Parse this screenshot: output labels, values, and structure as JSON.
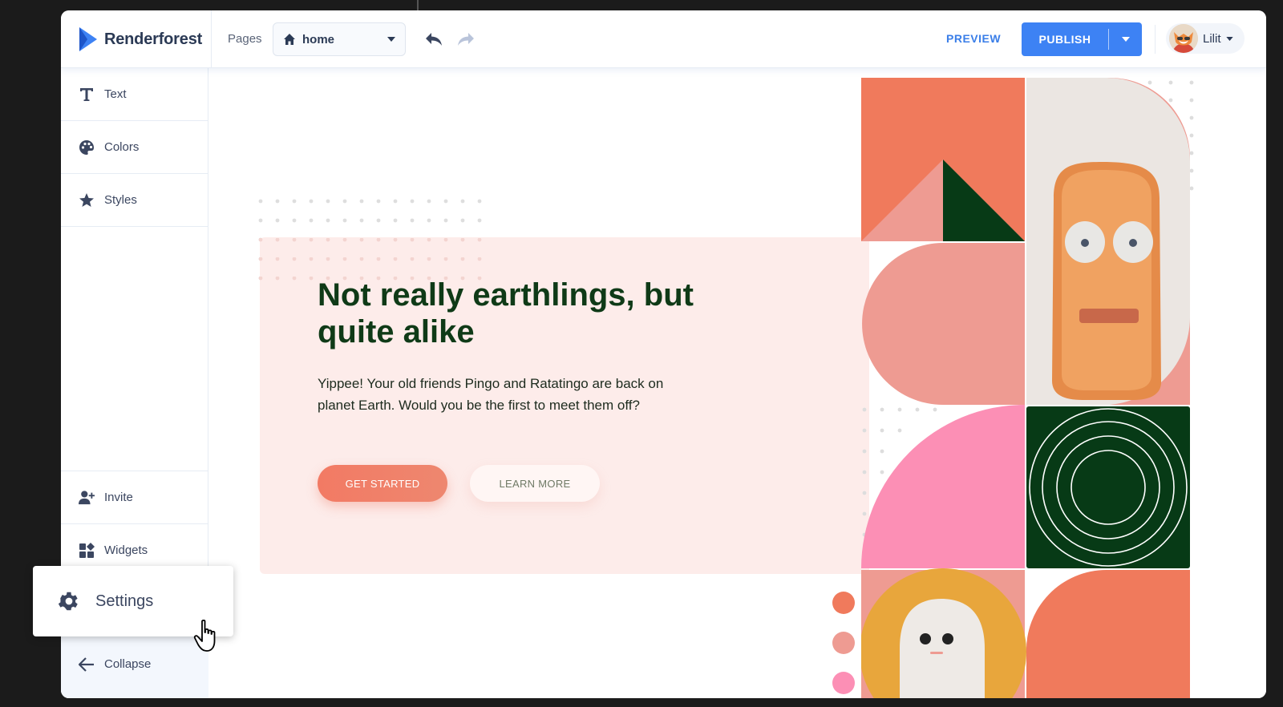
{
  "app": {
    "name": "Renderforest"
  },
  "header": {
    "pages_label": "Pages",
    "page_select": {
      "value": "home",
      "icon": "home-icon"
    },
    "preview_label": "PREVIEW",
    "publish_label": "PUBLISH",
    "user": {
      "name": "Lilit"
    }
  },
  "sidebar": {
    "top_items": [
      {
        "label": "Text",
        "icon": "text-icon"
      },
      {
        "label": "Colors",
        "icon": "palette-icon"
      },
      {
        "label": "Styles",
        "icon": "star-icon"
      }
    ],
    "bottom_items": [
      {
        "label": "Invite",
        "icon": "add-user-icon"
      },
      {
        "label": "Widgets",
        "icon": "widgets-icon"
      },
      {
        "label": "Collapse",
        "icon": "arrow-left-icon"
      }
    ]
  },
  "settings_popup": {
    "label": "Settings",
    "icon": "gear-icon"
  },
  "hero": {
    "title": "Not really earthlings, but quite alike",
    "body": "Yippee! Your old friends Pingo and Ratatingo are back on planet Earth. Would you be the first to meet them off?",
    "primary_button": "GET STARTED",
    "secondary_button": "LEARN MORE"
  },
  "colors": {
    "accent_blue": "#3d82f4",
    "dark_green": "#0f3a17",
    "coral": "#f07a5c",
    "pink": "#fc8fb5",
    "blush": "#ee9b92",
    "panel_bg": "#fdecea"
  }
}
